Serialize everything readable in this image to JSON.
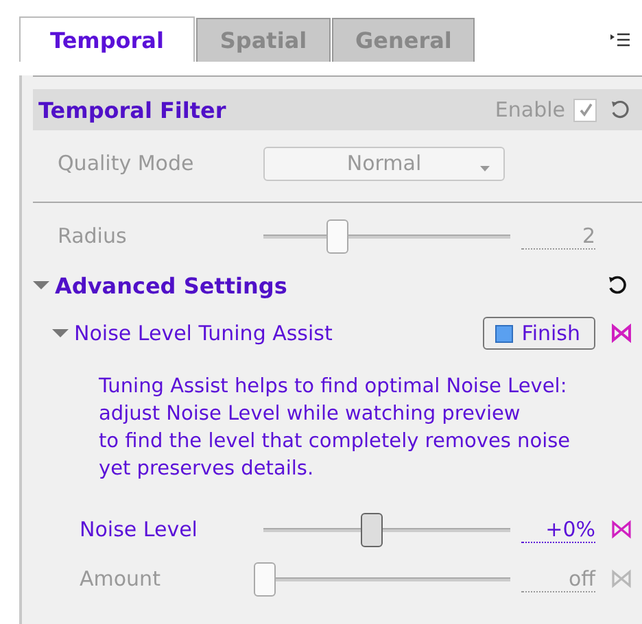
{
  "tabs": [
    {
      "label": "Temporal",
      "selected": true
    },
    {
      "label": "Spatial",
      "selected": false
    },
    {
      "label": "General",
      "selected": false
    }
  ],
  "section": {
    "title": "Temporal Filter",
    "enable_label": "Enable",
    "enabled": true,
    "enable_disabled": true
  },
  "quality_mode": {
    "label": "Quality Mode",
    "value": "Normal",
    "disabled": true
  },
  "radius": {
    "label": "Radius",
    "level": 0.27,
    "reading": "2",
    "disabled": true
  },
  "advanced": {
    "title": "Advanced Settings",
    "expanded": true
  },
  "assist": {
    "title": "Noise Level Tuning Assist",
    "expanded": true,
    "button": "Finish",
    "help_lines": [
      "Tuning Assist helps to find optimal Noise Level:",
      "adjust Noise Level while watching preview",
      "to find the level that completely removes noise",
      "yet preserves details."
    ]
  },
  "sliders": [
    {
      "label": "Noise Level",
      "level": 0.4,
      "reading": "+0%",
      "disabled": false,
      "linked": true
    },
    {
      "label": "Amount",
      "level": 0,
      "reading": "off",
      "disabled": true,
      "linked": false
    }
  ]
}
